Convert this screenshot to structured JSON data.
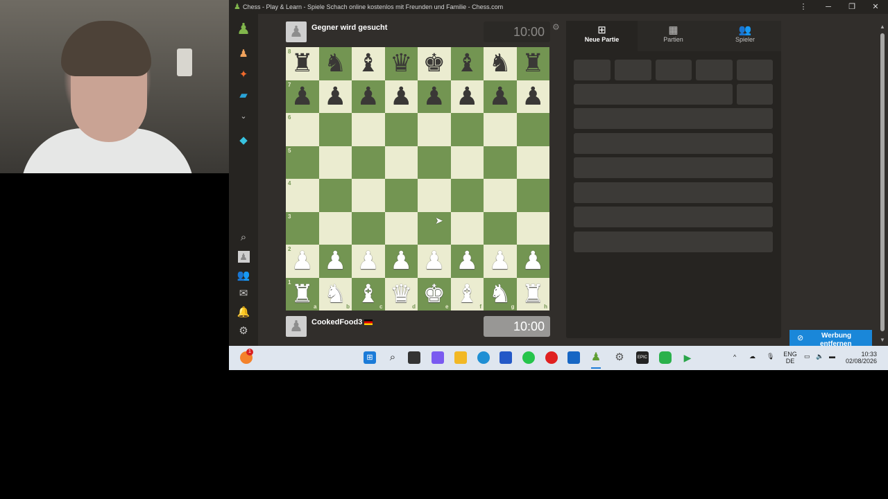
{
  "window": {
    "title": "Chess - Play & Learn - Spiele Schach online kostenlos mit Freunden und Familie - Chess.com"
  },
  "opponent": {
    "name": "Gegner wird gesucht",
    "clock": "10:00"
  },
  "player": {
    "name": "CookedFood3",
    "flag": "DE",
    "clock": "10:00"
  },
  "board": {
    "ranks": [
      "8",
      "7",
      "6",
      "5",
      "4",
      "3",
      "2",
      "1"
    ],
    "files": [
      "a",
      "b",
      "c",
      "d",
      "e",
      "f",
      "g",
      "h"
    ],
    "position": [
      [
        "♜",
        "♞",
        "♝",
        "♛",
        "♚",
        "♝",
        "♞",
        "♜"
      ],
      [
        "♟",
        "♟",
        "♟",
        "♟",
        "♟",
        "♟",
        "♟",
        "♟"
      ],
      [
        "",
        "",
        "",
        "",
        "",
        "",
        "",
        ""
      ],
      [
        "",
        "",
        "",
        "",
        "",
        "",
        "",
        ""
      ],
      [
        "",
        "",
        "",
        "",
        "",
        "",
        "",
        ""
      ],
      [
        "",
        "",
        "",
        "",
        "",
        "",
        "",
        ""
      ],
      [
        "♙",
        "♙",
        "♙",
        "♙",
        "♙",
        "♙",
        "♙",
        "♙"
      ],
      [
        "♖",
        "♘",
        "♗",
        "♕",
        "♔",
        "♗",
        "♘",
        "♖"
      ]
    ],
    "colors": {
      "light": "#ebecd0",
      "dark": "#739552"
    }
  },
  "panel": {
    "tabs": [
      {
        "label": "Neue Partie",
        "icon": "plus-square-icon",
        "active": true
      },
      {
        "label": "Partien",
        "icon": "chessboard-icon",
        "active": false
      },
      {
        "label": "Spieler",
        "icon": "players-icon",
        "active": false
      }
    ]
  },
  "ad_button": {
    "label_line1": "Werbung",
    "label_line2": "entfernen"
  },
  "sidebar": {
    "top_icons": [
      "chess-logo-icon",
      "pawn-icon",
      "puzzle-icon",
      "learn-icon",
      "chevron-down-icon",
      "diamond-icon"
    ],
    "bottom_icons": [
      "search-icon",
      "avatar-icon",
      "friends-icon",
      "mail-icon",
      "bell-icon",
      "gear-icon"
    ]
  },
  "taskbar": {
    "apps": [
      "start-icon",
      "search-icon",
      "task-view-icon",
      "copilot-icon",
      "explorer-icon",
      "edge-icon",
      "store-icon",
      "whatsapp-icon",
      "youtube-icon",
      "outlook-icon",
      "chess-icon",
      "settings-icon",
      "epic-icon",
      "game-icon",
      "media-icon"
    ],
    "notification_count": "1",
    "lang_line1": "ENG",
    "lang_line2": "DE",
    "time": "10:33",
    "date": "02/08/2026"
  }
}
